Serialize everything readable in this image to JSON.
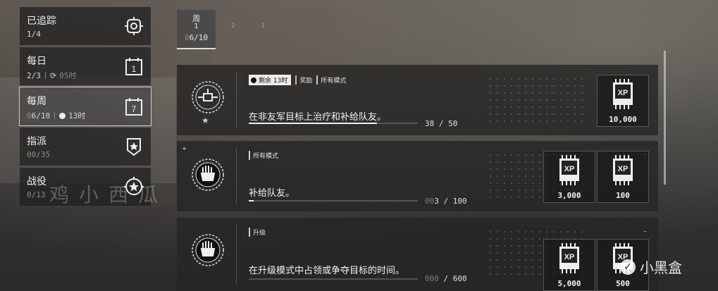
{
  "sidebar": {
    "categories": [
      {
        "label": "已追踪",
        "progress_value": "1/4",
        "icon": "target-icon"
      },
      {
        "label": "每日",
        "progress_value": "2/3",
        "refresh": "05时",
        "icon": "calendar-1-icon",
        "icon_text": "1"
      },
      {
        "label": "每周",
        "progress_prefix": "0",
        "progress_value": "6/10",
        "timer": "13时",
        "icon": "calendar-7-icon",
        "icon_text": "7"
      },
      {
        "label": "指派",
        "progress_dim": "00/35",
        "icon": "rank-badge-icon"
      },
      {
        "label": "战役",
        "progress_dim": "0/13",
        "icon": "campaign-crosshair-icon"
      }
    ]
  },
  "week_tabs": {
    "active": {
      "line1": "周",
      "line2": "1",
      "progress_prefix": "0",
      "progress_value": "6/10"
    },
    "others": [
      "2",
      "3"
    ]
  },
  "missions": [
    {
      "tags": {
        "timer": "剩余 13时",
        "tag2": "奖励",
        "tag3": "所有模式"
      },
      "description": "在非友军目标上治疗和补给队友。",
      "progress_current": "38",
      "progress_total": "/ 50",
      "progress_fraction": 0.76,
      "rewards": [
        {
          "label": "XP",
          "amount": "10,000"
        }
      ]
    },
    {
      "tags": {
        "tag1": "所有模式"
      },
      "description": "补给队友。",
      "progress_dim": "00",
      "progress_current": "3",
      "progress_total": "/ 100",
      "progress_fraction": 0.03,
      "rewards": [
        {
          "label": "XP",
          "amount": "3,000"
        },
        {
          "label": "XP",
          "amount": "100"
        }
      ]
    },
    {
      "tags": {
        "tag1": "升级"
      },
      "description": "在升级模式中占领或争夺目标的时间。",
      "progress_dim": "000",
      "progress_total": "/ 600",
      "progress_fraction": 0.0,
      "rewards": [
        {
          "label": "XP",
          "amount": "5,000"
        },
        {
          "label": "XP",
          "amount": "500"
        }
      ]
    }
  ],
  "watermark": "鸡小西瓜",
  "logo_text": "小黑盒",
  "colors": {
    "panel": "#262626",
    "active_outline": "#ffffff",
    "tag_accent": "#c9b98a"
  }
}
